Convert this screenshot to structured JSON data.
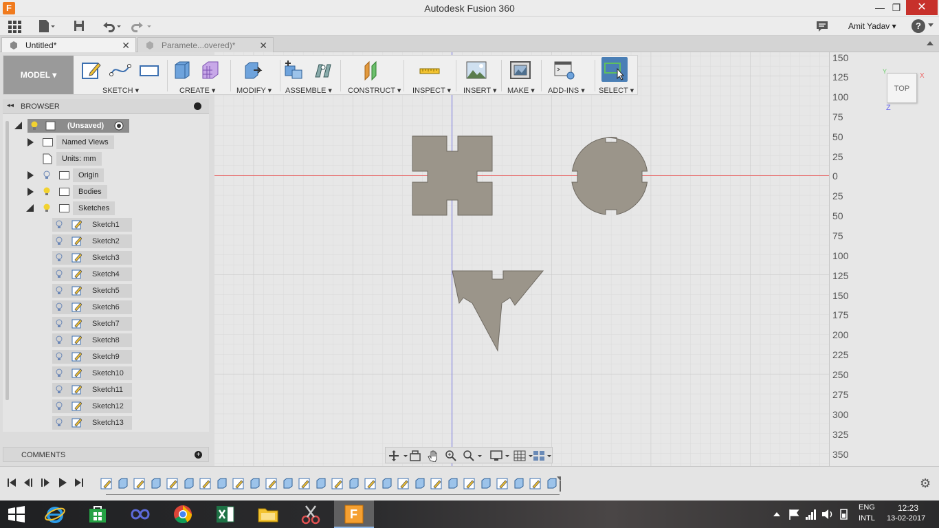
{
  "window": {
    "title": "Autodesk Fusion 360",
    "minimize_glyph": "—",
    "restore_glyph": "❐",
    "close_glyph": "✕"
  },
  "quickbar": {
    "user_label": "Amit Yadav ▾",
    "help_label": "?"
  },
  "tabs": [
    {
      "label": "Untitled*",
      "active": true
    },
    {
      "label": "Paramete...overed)*",
      "active": false
    }
  ],
  "toolbar": {
    "workspace_label": "MODEL ▾",
    "groups": [
      {
        "label": "SKETCH ▾"
      },
      {
        "label": "CREATE ▾"
      },
      {
        "label": "MODIFY ▾"
      },
      {
        "label": "ASSEMBLE ▾"
      },
      {
        "label": "CONSTRUCT ▾"
      },
      {
        "label": "INSPECT ▾"
      },
      {
        "label": "INSERT ▾"
      },
      {
        "label": "MAKE ▾"
      },
      {
        "label": "ADD-INS ▾"
      },
      {
        "label": "SELECT ▾"
      }
    ]
  },
  "browser": {
    "title": "BROWSER",
    "root": "(Unsaved)",
    "named_views": "Named Views",
    "units": "Units: mm",
    "origin": "Origin",
    "bodies": "Bodies",
    "sketches_folder": "Sketches",
    "sketches": [
      "Sketch1",
      "Sketch2",
      "Sketch3",
      "Sketch4",
      "Sketch5",
      "Sketch6",
      "Sketch7",
      "Sketch8",
      "Sketch9",
      "Sketch10",
      "Sketch11",
      "Sketch12",
      "Sketch13"
    ]
  },
  "comments": {
    "title": "COMMENTS"
  },
  "ruler": {
    "labels": [
      "150",
      "125",
      "100",
      "75",
      "50",
      "25",
      "0",
      "25",
      "50",
      "75",
      "100",
      "125",
      "150",
      "175",
      "200",
      "225",
      "250",
      "275",
      "300",
      "325",
      "350"
    ]
  },
  "viewcube": {
    "face": "TOP",
    "axis_x": "X",
    "axis_y": "Y",
    "axis_z": "Z"
  },
  "taskbar": {
    "lang_top": "ENG",
    "lang_bottom": "INTL",
    "time": "12:23",
    "date": "13-02-2017"
  },
  "colors": {
    "accent": "#4a7fb6",
    "shape_fill": "#9b958a",
    "x_axis": "#e86a6a",
    "y_axis": "#7a7ae8",
    "close_button": "#c7312b"
  }
}
